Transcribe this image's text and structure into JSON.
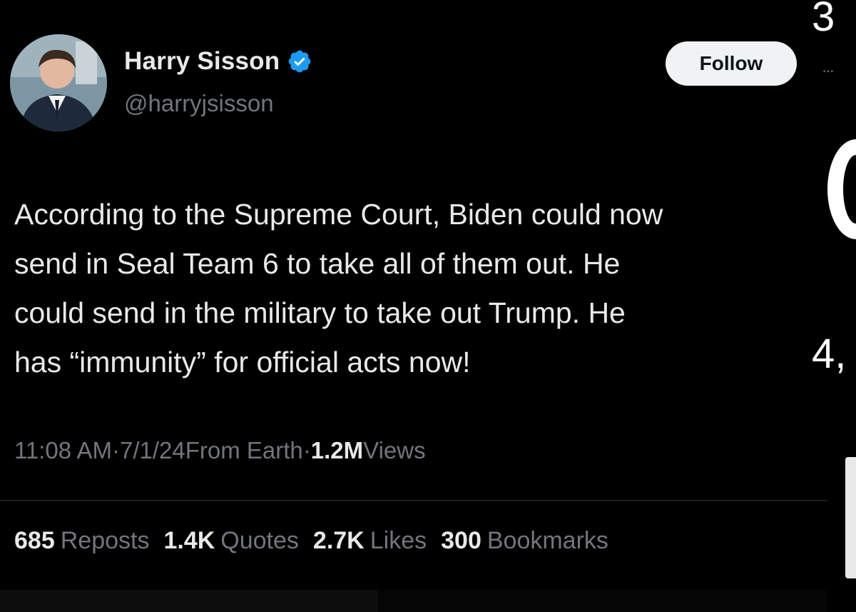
{
  "author": {
    "display_name": "Harry Sisson",
    "handle": "@harryjsisson",
    "verified_icon": "verified-badge-icon",
    "avatar_icon": "avatar"
  },
  "actions": {
    "follow_label": "Follow"
  },
  "tweet": {
    "text": "According to the Supreme Court, Biden could now\nsend in Seal Team 6 to take all of them out. He\ncould send in the military to take out Trump. He\nhas “immunity” for official acts now!"
  },
  "meta": {
    "time": "11:08 AM",
    "sep1": " · ",
    "date": "7/1/24",
    "source": " From Earth",
    "sep2": " · ",
    "views_count": "1.2M",
    "views_label": " Views"
  },
  "stats": [
    {
      "count": "685",
      "label": "Reposts"
    },
    {
      "count": "1.4K",
      "label": "Quotes"
    },
    {
      "count": "2.7K",
      "label": "Likes"
    },
    {
      "count": "300",
      "label": "Bookmarks"
    }
  ],
  "edge": {
    "top_digit": "3",
    "mid_digit": "4,"
  },
  "colors": {
    "background": "#000000",
    "text_primary": "#e7e9ea",
    "text_secondary": "#71767b",
    "verified_blue": "#1d9bf0",
    "follow_bg": "#eff3f4"
  }
}
